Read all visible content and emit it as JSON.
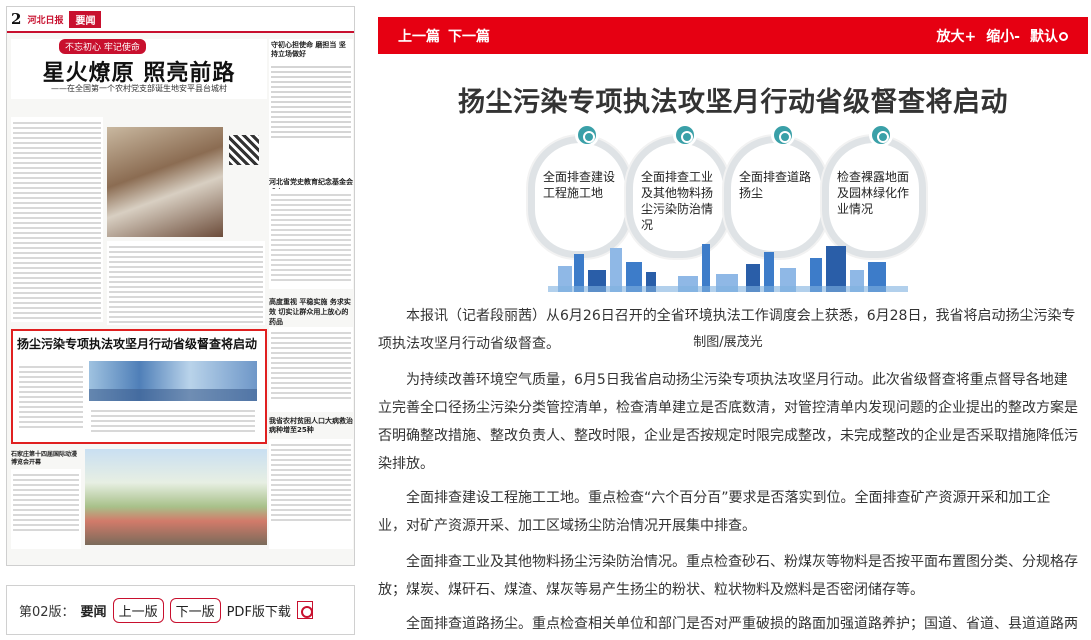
{
  "newspaper": {
    "page_number": "2",
    "logo": "河北日报",
    "section": "要闻",
    "lead_tag": "不忘初心 牢记使命",
    "lead_title": "星火燎原 照亮前路",
    "lead_subtitle": "——在全国第一个农村党支部诞生地安平县台城村",
    "side_head_1": "守初心担使命 磨担当 坚持立场做好",
    "side_head_2": "河北省党史教育纪念基金会成立",
    "side_head_3": "高度重视 平稳实施 务求实效 切实让群众用上放心的药品",
    "highlight_title": "扬尘污染专项执法攻坚月行动省级督查将启动",
    "side_head_4": "我省农村贫困人口大病救治病种增至25种",
    "side_head_5": "石家庄第十四届国际动漫博览会开幕"
  },
  "pager": {
    "edition_label": "第02版：",
    "edition_name": "要闻",
    "prev_label": "上一版",
    "next_label": "下一版",
    "pdf_label": "PDF版下载"
  },
  "toolbar": {
    "prev_article": "上一篇",
    "next_article": "下一篇",
    "zoom_in": "放大+",
    "zoom_out": "缩小-",
    "default": "默认"
  },
  "article": {
    "title": "扬尘污染专项执法攻坚月行动省级督查将启动",
    "infographic_items": [
      "全面排查建设工程施工地",
      "全面排查工业及其他物料扬尘污染防治情况",
      "全面排查道路扬尘",
      "检查裸露地面及园林绿化作业情况"
    ],
    "credit": "制图/展茂光",
    "paragraphs": [
      "本报讯（记者段丽茜）从6月26日召开的全省环境执法工作调度会上获悉，6月28日，我省将启动扬尘污染专项执法攻坚月行动省级督查。",
      "为持续改善环境空气质量，6月5日我省启动扬尘污染专项执法攻坚月行动。此次省级督查将重点督导各地建立完善全口径扬尘污染分类管控清单，检查清单建立是否底数清，对管控清单内发现问题的企业提出的整改方案是否明确整改措施、整改负责人、整改时限，企业是否按规定时限完成整改，未完成整改的企业是否采取措施降低污染排放。",
      "全面排查建设工程施工工地。重点检查“六个百分百”要求是否落实到位。全面排查矿产资源开采和加工企业，对矿产资源开采、加工区域扬尘防治情况开展集中排查。",
      "全面排查工业及其他物料扬尘污染防治情况。重点检查砂石、粉煤灰等物料是否按平面布置图分类、分规格存放；煤炭、煤矸石、煤渣、煤灰等易产生扬尘的粉状、粒状物料及燃料是否密闭储存等。",
      "全面排查道路扬尘。重点检查相关单位和部门是否对严重破损的路面加强道路养护；国道、省道、县道道路两"
    ]
  },
  "colors": {
    "accent_red": "#e60012",
    "highlight_border": "#e02020",
    "infographic_pin": "#3aa0a8",
    "skyline_blue": "#3d7cc9"
  }
}
